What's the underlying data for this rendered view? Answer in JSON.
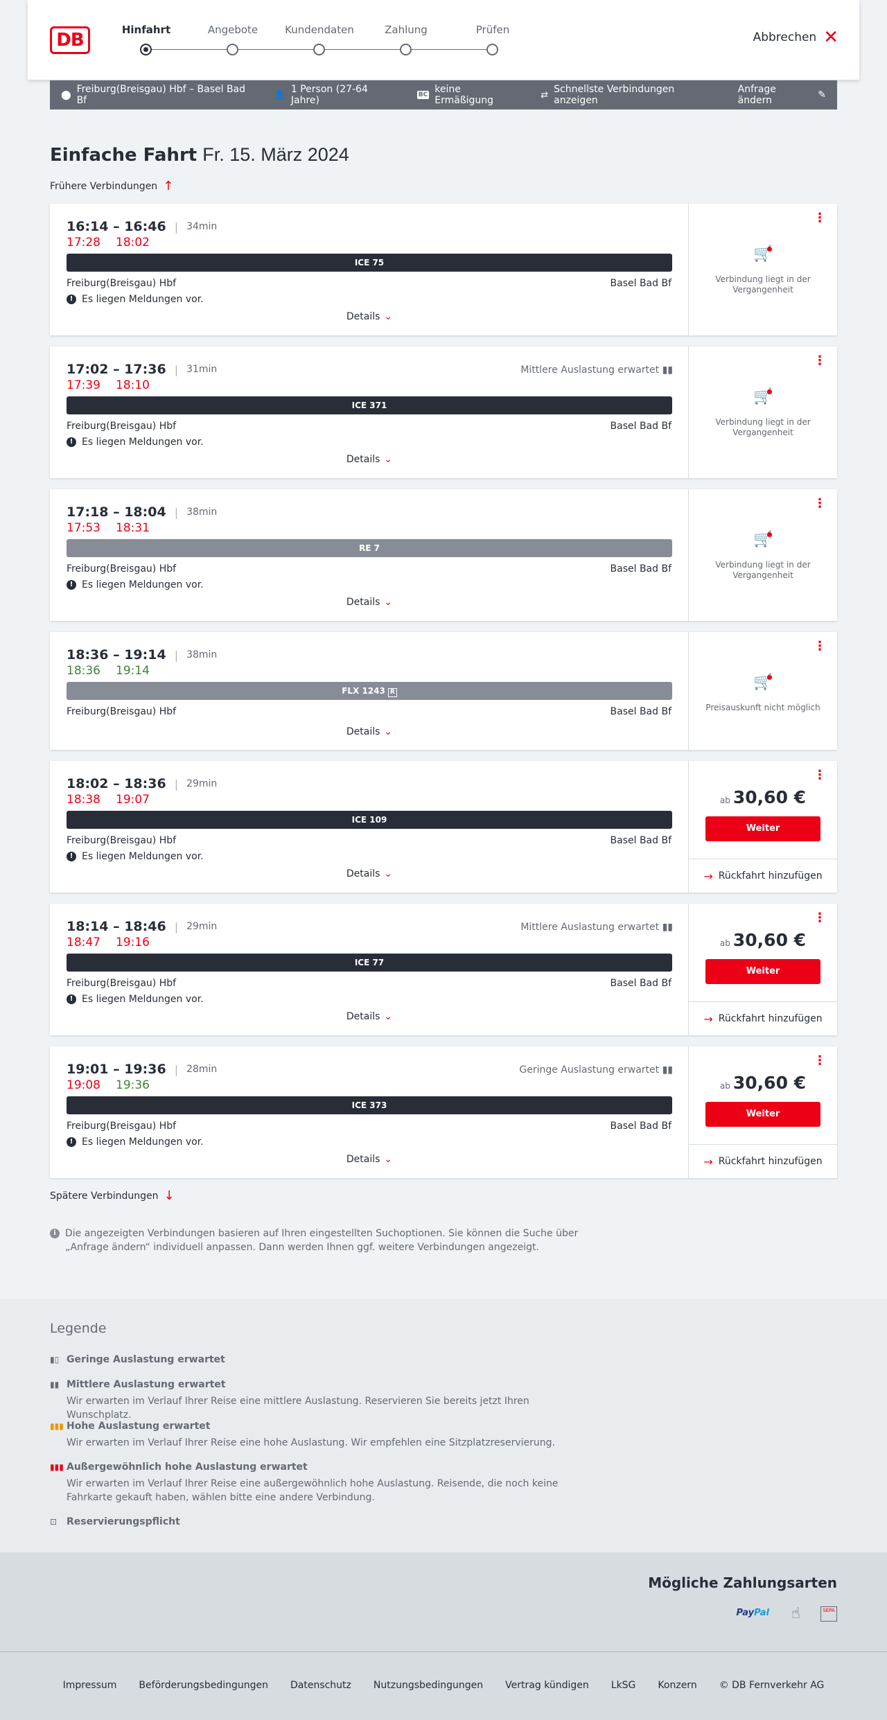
{
  "header": {
    "logo": "DB",
    "cancel_label": "Abbrechen",
    "steps": [
      {
        "label": "Hinfahrt",
        "active": true
      },
      {
        "label": "Angebote"
      },
      {
        "label": "Kundendaten"
      },
      {
        "label": "Zahlung"
      },
      {
        "label": "Prüfen"
      }
    ]
  },
  "search_bar": {
    "route": "Freiburg(Breisgau) Hbf – Basel Bad Bf",
    "passengers": "1 Person (27-64 Jahre)",
    "discount_badge": "BC",
    "discount": "keine Ermäßigung",
    "option": "Schnellste Verbindungen anzeigen",
    "change_label": "Anfrage ändern"
  },
  "page": {
    "title": "Einfache Fahrt",
    "date": "Fr. 15. März 2024",
    "earlier_label": "Frühere Verbindungen",
    "later_label": "Spätere Verbindungen",
    "details_label": "Details"
  },
  "connections": [
    {
      "times": "16:14 – 16:46",
      "duration": "34min",
      "rt_dep": "17:28",
      "rt_arr": "18:02",
      "rt_status": "late",
      "train": "ICE 75",
      "train_type": "ice",
      "from": "Freiburg(Breisgau) Hbf",
      "to": "Basel Bad Bf",
      "message": "Es liegen Meldungen vor.",
      "side_text": "Verbindung liegt in der Vergangenheit",
      "load": ""
    },
    {
      "times": "17:02 – 17:36",
      "duration": "31min",
      "rt_dep": "17:39",
      "rt_arr": "18:10",
      "rt_status": "late",
      "train": "ICE 371",
      "train_type": "ice",
      "from": "Freiburg(Breisgau) Hbf",
      "to": "Basel Bad Bf",
      "message": "Es liegen Meldungen vor.",
      "side_text": "Verbindung liegt in der Vergangenheit",
      "load": "Mittlere Auslastung erwartet"
    },
    {
      "times": "17:18 – 18:04",
      "duration": "38min",
      "rt_dep": "17:53",
      "rt_arr": "18:31",
      "rt_status": "late",
      "train": "RE 7",
      "train_type": "reg",
      "from": "Freiburg(Breisgau) Hbf",
      "to": "Basel Bad Bf",
      "message": "Es liegen Meldungen vor.",
      "side_text": "Verbindung liegt in der Vergangenheit",
      "load": ""
    },
    {
      "times": "18:36 – 19:14",
      "duration": "38min",
      "rt_dep": "18:36",
      "rt_arr": "19:14",
      "rt_status": "ok",
      "train": "FLX 1243",
      "train_badge": "R",
      "train_type": "reg",
      "from": "Freiburg(Breisgau) Hbf",
      "to": "Basel Bad Bf",
      "message": "",
      "side_text": "Preisauskunft nicht möglich",
      "load": ""
    },
    {
      "times": "18:02 – 18:36",
      "duration": "29min",
      "rt_dep": "18:38",
      "rt_arr": "19:07",
      "rt_status": "late",
      "train": "ICE 109",
      "train_type": "ice",
      "from": "Freiburg(Breisgau) Hbf",
      "to": "Basel Bad Bf",
      "message": "Es liegen Meldungen vor.",
      "price_prefix": "ab",
      "price": "30,60 €",
      "button": "Weiter",
      "return_label": "Rückfahrt hinzufügen",
      "load": ""
    },
    {
      "times": "18:14 – 18:46",
      "duration": "29min",
      "rt_dep": "18:47",
      "rt_arr": "19:16",
      "rt_status": "late",
      "train": "ICE 77",
      "train_type": "ice",
      "from": "Freiburg(Breisgau) Hbf",
      "to": "Basel Bad Bf",
      "message": "Es liegen Meldungen vor.",
      "price_prefix": "ab",
      "price": "30,60 €",
      "button": "Weiter",
      "return_label": "Rückfahrt hinzufügen",
      "load": "Mittlere Auslastung erwartet"
    },
    {
      "times": "19:01 – 19:36",
      "duration": "28min",
      "rt_dep": "19:08",
      "rt_arr": "19:36",
      "rt_status": "mixed",
      "train": "ICE 373",
      "train_type": "ice",
      "from": "Freiburg(Breisgau) Hbf",
      "to": "Basel Bad Bf",
      "message": "Es liegen Meldungen vor.",
      "price_prefix": "ab",
      "price": "30,60 €",
      "button": "Weiter",
      "return_label": "Rückfahrt hinzufügen",
      "load": "Geringe Auslastung erwartet"
    }
  ],
  "note": "Die angezeigten Verbindungen basieren auf Ihren eingestellten Suchoptionen. Sie können die Suche über „Anfrage ändern“ individuell anpassen. Dann werden Ihnen ggf. weitere Verbindungen angezeigt.",
  "legend": {
    "title": "Legende",
    "items": [
      {
        "title": "Geringe Auslastung erwartet",
        "desc": ""
      },
      {
        "title": "Mittlere Auslastung erwartet",
        "desc": "Wir erwarten im Verlauf Ihrer Reise eine mittlere Auslastung. Reservieren Sie bereits jetzt Ihren Wunschplatz."
      },
      {
        "title": "Hohe Auslastung erwartet",
        "desc": "Wir erwarten im Verlauf Ihrer Reise eine hohe Auslastung. Wir empfehlen eine Sitzplatzreservierung."
      },
      {
        "title": "Außergewöhnlich hohe Auslastung erwartet",
        "desc": "Wir erwarten im Verlauf Ihrer Reise eine außergewöhnlich hohe Auslastung. Reisende, die noch keine Fahrkarte gekauft haben, wählen bitte eine andere Verbindung."
      },
      {
        "title": "Reservierungspflicht",
        "desc": ""
      }
    ]
  },
  "payment": {
    "title": "Mögliche Zahlungsarten",
    "paypal_a": "Pay",
    "paypal_b": "Pal",
    "sepa": "SEPA"
  },
  "footer": {
    "links": [
      "Impressum",
      "Beförderungsbedingungen",
      "Datenschutz",
      "Nutzungsbedingungen",
      "Vertrag kündigen",
      "LkSG",
      "Konzern",
      "© DB Fernverkehr AG"
    ]
  },
  "colors": {
    "red": "#ec0016",
    "green": "#408335",
    "dark": "#282d37",
    "grey": "#646973"
  }
}
